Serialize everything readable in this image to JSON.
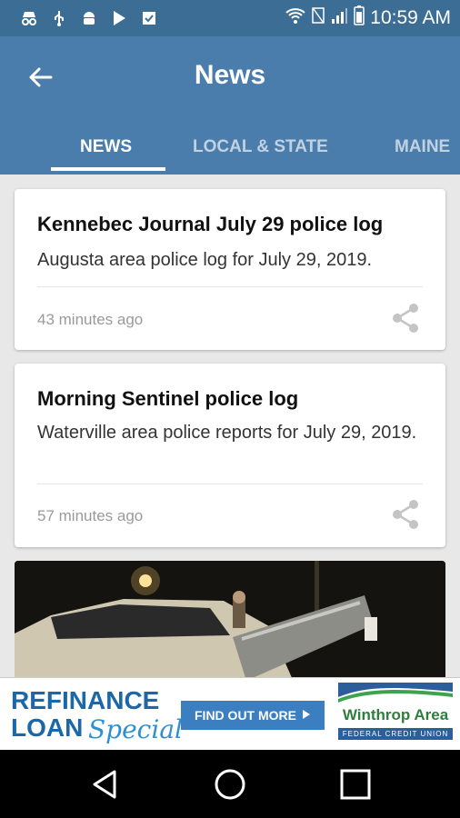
{
  "status_bar": {
    "time": "10:59 AM",
    "icons": [
      "incognito-icon",
      "usb-icon",
      "android-icon",
      "play-store-icon",
      "check-app-icon",
      "wifi-icon",
      "no-sim-icon",
      "signal-icon",
      "battery-icon"
    ]
  },
  "toolbar": {
    "title": "News"
  },
  "tabs": [
    {
      "label": "NEWS",
      "active": true
    },
    {
      "label": "LOCAL & STATE",
      "active": false
    },
    {
      "label": "MAINE",
      "active": false
    }
  ],
  "articles": [
    {
      "title": "Kennebec Journal July 29 police log",
      "description": " Augusta area police log for July 29, 2019.",
      "time": "43 minutes ago"
    },
    {
      "title": "Morning Sentinel police log",
      "description": " Waterville area police reports for July 29, 2019.",
      "time": "57 minutes ago"
    }
  ],
  "ad": {
    "line1": "REFINANCE",
    "line2": "LOAN",
    "special": "Special",
    "button": "FIND OUT MORE",
    "bank_name": "Winthrop Area",
    "bank_sub": "FEDERAL CREDIT UNION"
  },
  "colors": {
    "toolbar": "#4a7dab",
    "status_bar": "#3c6d94",
    "ad_blue": "#1b67a8"
  }
}
